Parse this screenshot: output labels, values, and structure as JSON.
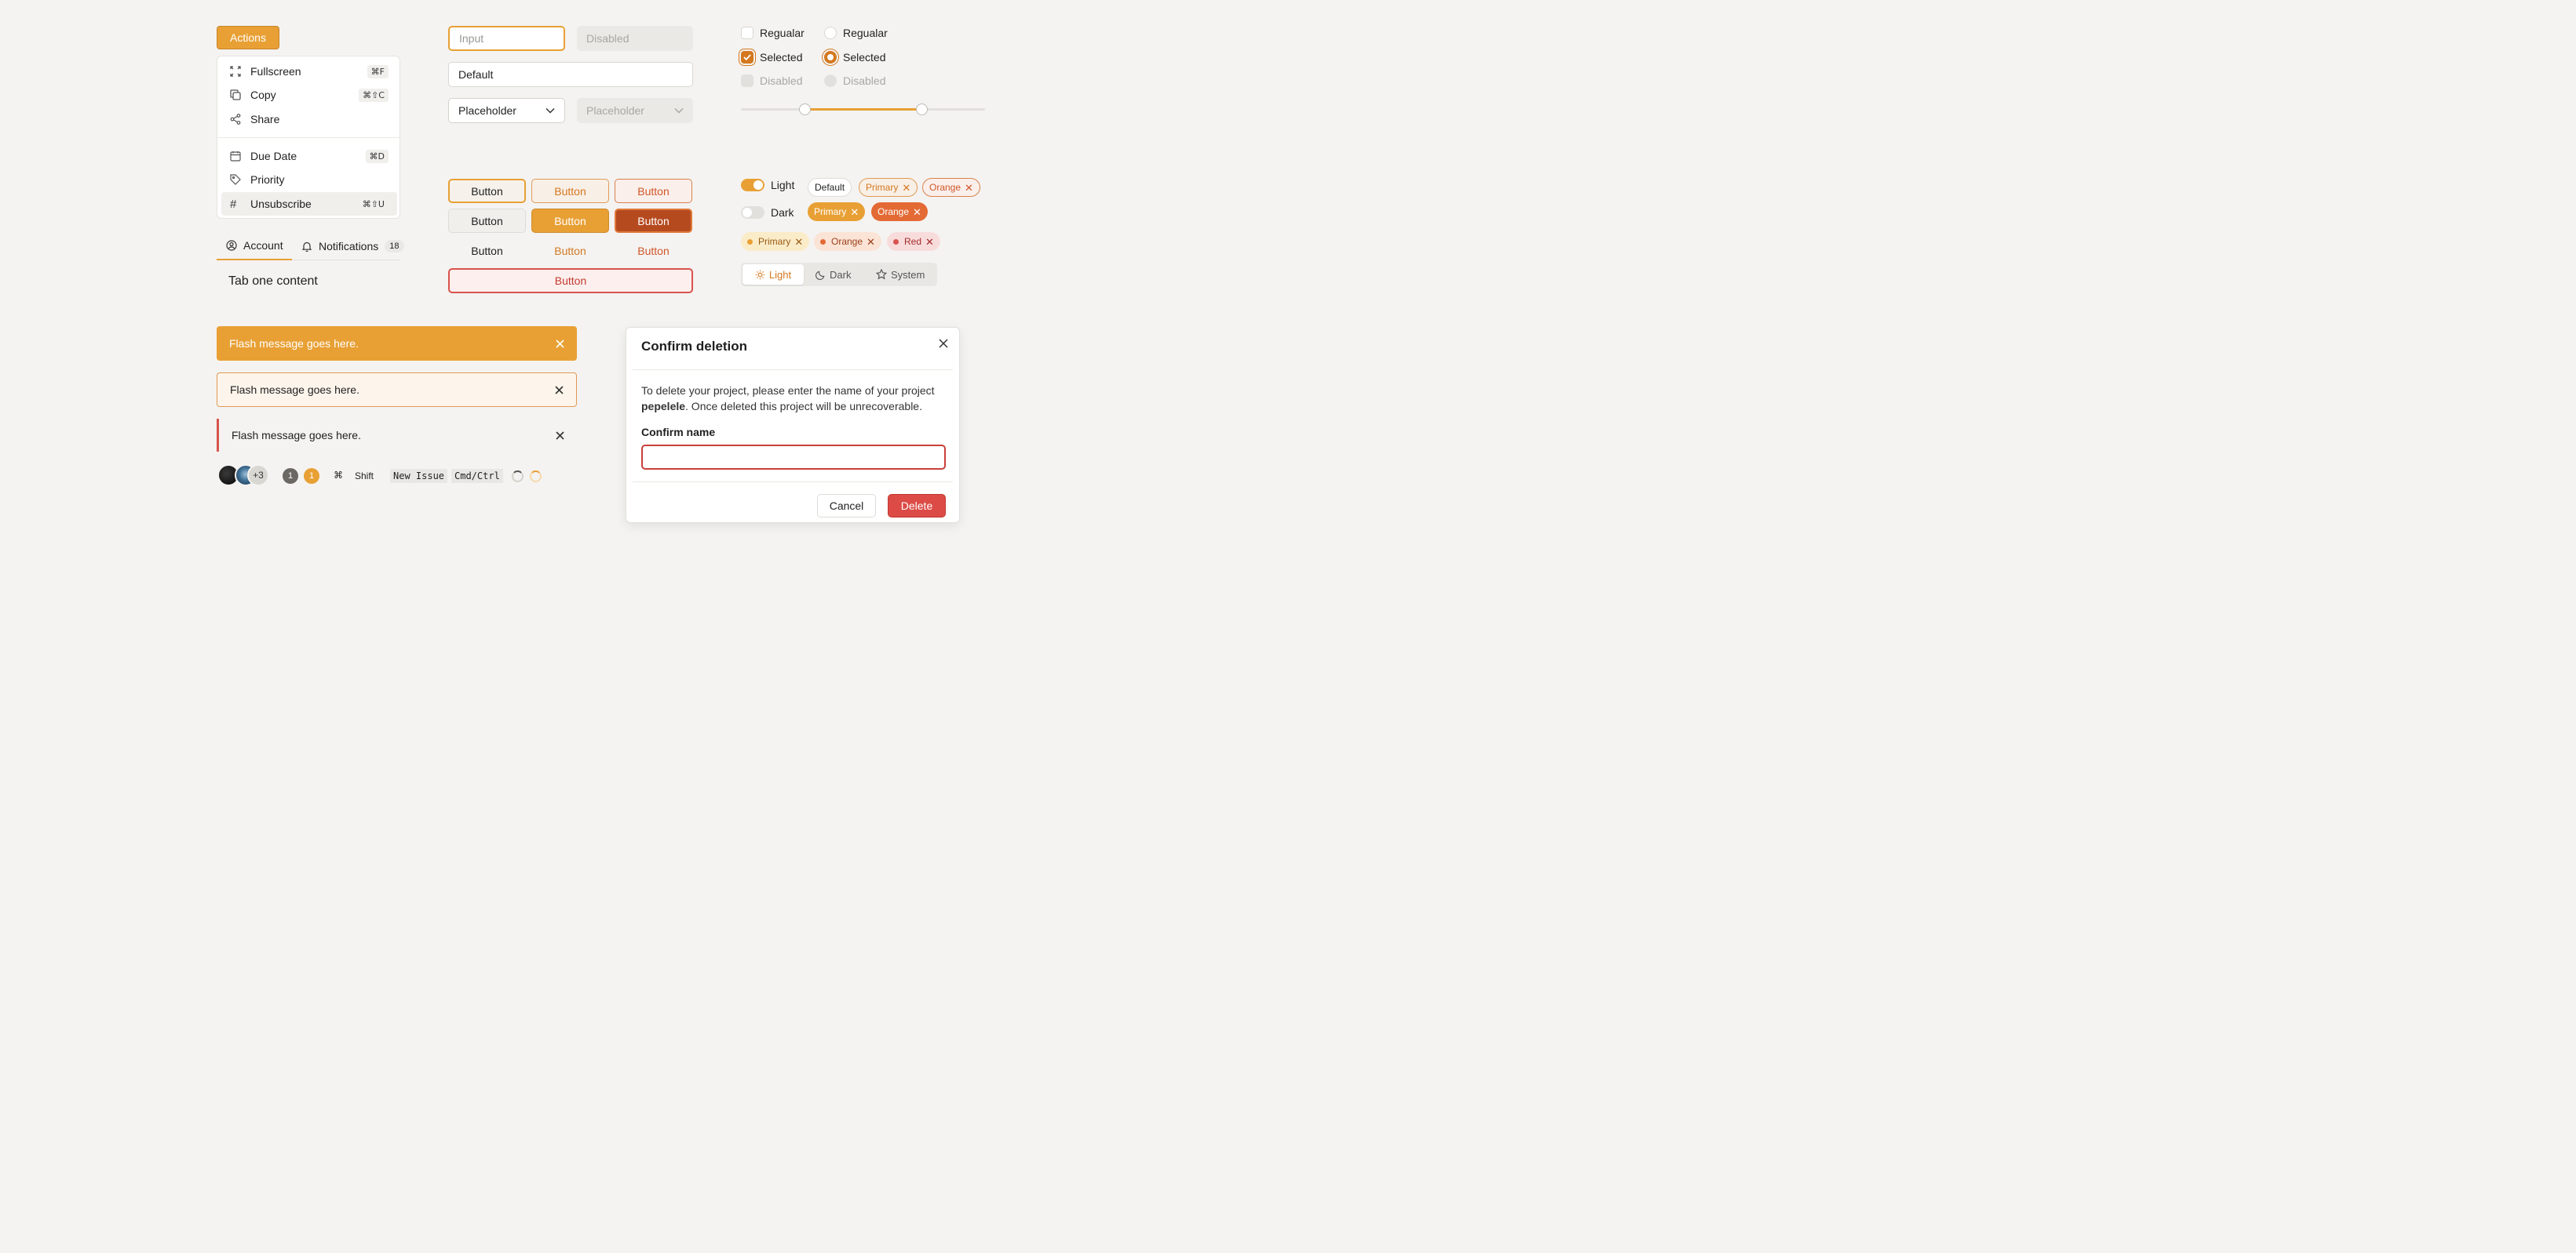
{
  "menu": {
    "trigger_label": "Actions",
    "items": [
      {
        "label": "Fullscreen",
        "shortcut": "⌘F",
        "icon": "fullscreen-icon"
      },
      {
        "label": "Copy",
        "shortcut": "⌘⇧C",
        "icon": "copy-icon"
      },
      {
        "label": "Share",
        "shortcut": "",
        "icon": "share-icon"
      },
      {
        "label": "Due Date",
        "shortcut": "⌘D",
        "icon": "calendar-icon"
      },
      {
        "label": "Priority",
        "shortcut": "",
        "icon": "tag-icon"
      },
      {
        "label": "Unsubscribe",
        "shortcut": "⌘⇧U",
        "icon": "hash-icon"
      }
    ]
  },
  "tabs": {
    "items": [
      {
        "label": "Account",
        "icon": "user-circle-icon"
      },
      {
        "label": "Notifications",
        "icon": "bell-icon",
        "count": "18"
      }
    ],
    "content": "Tab one content"
  },
  "inputs": {
    "focused_placeholder": "Input",
    "disabled_placeholder": "Disabled",
    "default_value": "Default",
    "select_placeholder": "Placeholder",
    "select_disabled_placeholder": "Placeholder"
  },
  "checkboxes": {
    "regular": "Regualar",
    "selected": "Selected",
    "disabled": "Disabled"
  },
  "radios": {
    "regular": "Regualar",
    "selected": "Selected",
    "disabled": "Disabled"
  },
  "slider": {
    "low": 0.26,
    "high": 0.74
  },
  "buttons": {
    "label": "Button"
  },
  "toggles": {
    "light": "Light",
    "dark": "Dark"
  },
  "badges": {
    "default": "Default",
    "primary": "Primary",
    "orange": "Orange",
    "red": "Red"
  },
  "segmented": {
    "light": "Light",
    "dark": "Dark",
    "system": "System"
  },
  "flash": {
    "message": "Flash message goes here."
  },
  "bottom": {
    "avatar_more": "+3",
    "badge_one": "1",
    "badge_two": "1",
    "cmd": "⌘",
    "shift": "Shift",
    "code_one": "New Issue",
    "code_two": "Cmd/Ctrl"
  },
  "dialog": {
    "title": "Confirm deletion",
    "body_prefix": "To delete your project, please enter the name of your project ",
    "project": "pepelele",
    "body_suffix": ". Once deleted this project will be unrecoverable.",
    "field_label": "Confirm name",
    "field_value": "",
    "cancel_label": "Cancel",
    "delete_label": "Delete"
  },
  "colors": {
    "primary": "#e8a035",
    "orange": "#e36a34",
    "danger": "#dc4b46"
  }
}
